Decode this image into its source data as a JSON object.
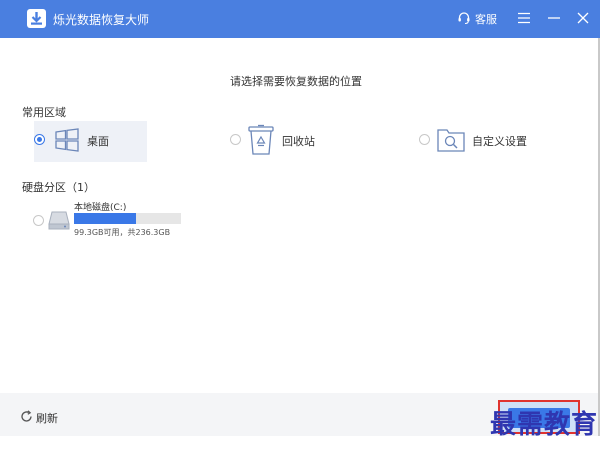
{
  "titlebar": {
    "title": "烁光数据恢复大师",
    "support_label": "客服"
  },
  "main": {
    "prompt": "请选择需要恢复数据的位置",
    "common_section": "常用区域",
    "options": [
      {
        "label": "桌面",
        "selected": true,
        "icon": "windows-icon"
      },
      {
        "label": "回收站",
        "selected": false,
        "icon": "recycle-bin-icon"
      },
      {
        "label": "自定义设置",
        "selected": false,
        "icon": "folder-search-icon"
      }
    ],
    "partition_section": "硬盘分区（1）",
    "drives": [
      {
        "name": "本地磁盘(C:)",
        "info": "99.3GB可用，共236.3GB",
        "used_fraction": 0.58,
        "selected": false
      }
    ]
  },
  "footer": {
    "refresh_label": "刷新"
  },
  "watermark": "最需教育",
  "colors": {
    "titlebar": "#4a7fe0",
    "accent": "#3a78e7",
    "highlight_border": "#e0342f",
    "watermark": "#2f36b0"
  }
}
